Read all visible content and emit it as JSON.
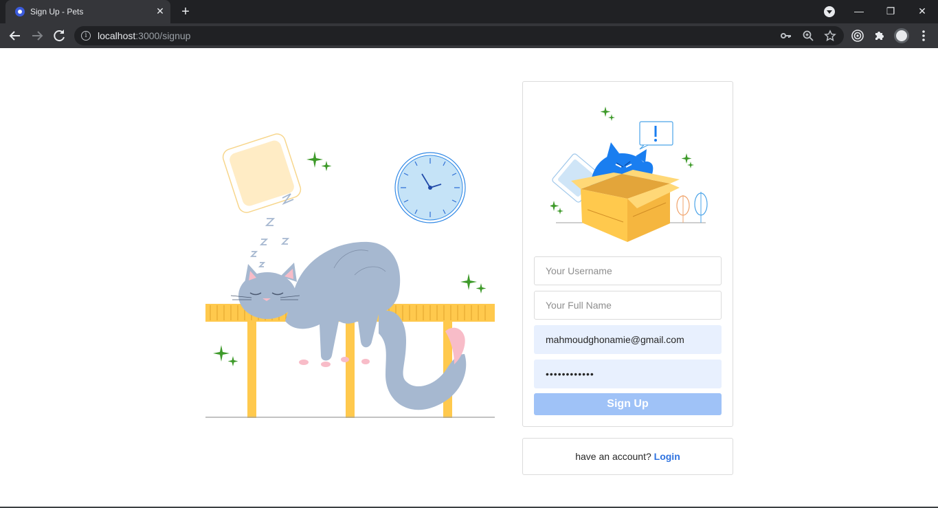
{
  "browser": {
    "tab_title": "Sign Up - Pets",
    "tab_close": "✕",
    "new_tab": "+",
    "url_host": "localhost",
    "url_path": ":3000/signup",
    "window_controls": {
      "minimize": "—",
      "restore": "❐",
      "close": "✕"
    }
  },
  "icons": {
    "back": "arrow-left-icon",
    "forward": "arrow-right-icon",
    "reload": "reload-icon",
    "site_info": "info-icon",
    "password_key": "key-icon",
    "zoom": "zoom-icon",
    "bookmark": "star-icon",
    "extension_circle": "target-icon",
    "extensions": "puzzle-icon",
    "menu": "kebab-menu-icon"
  },
  "signup": {
    "username_placeholder": "Your Username",
    "fullname_placeholder": "Your Full Name",
    "email_value": "mahmoudghonamie@gmail.com",
    "password_value": "••••••••••••",
    "submit_label": "Sign Up"
  },
  "login_prompt": {
    "text": "have an account? ",
    "link_label": "Login"
  },
  "colors": {
    "accent": "#2f73e0",
    "button_disabled": "#9fc2f7",
    "autofill_bg": "#e8f0fe",
    "cat_gray": "#a6b8d0",
    "table_yellow": "#ffc94d",
    "cat_blue": "#1a7ef0"
  }
}
